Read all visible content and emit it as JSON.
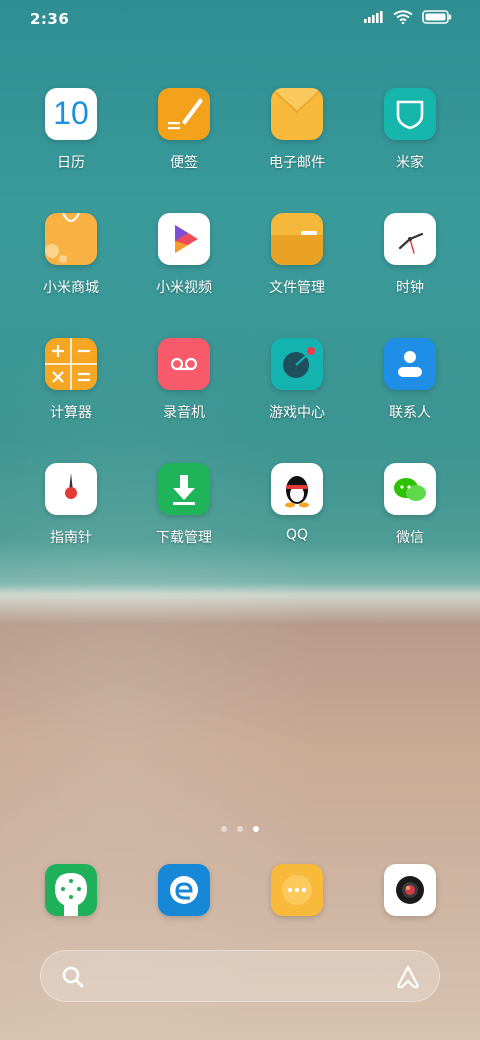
{
  "status_bar": {
    "time": "2:36",
    "icons": [
      "signal-icon",
      "wifi-icon",
      "battery-icon"
    ]
  },
  "apps": [
    {
      "label": "日历",
      "icon": "calendar-icon",
      "icon_text": "10",
      "color": "#ffffff"
    },
    {
      "label": "便签",
      "icon": "notes-icon",
      "color": "#f4a21b"
    },
    {
      "label": "电子邮件",
      "icon": "email-icon",
      "color": "#f9b93b"
    },
    {
      "label": "米家",
      "icon": "mihome-icon",
      "color": "#17b6ad"
    },
    {
      "label": "小米商城",
      "icon": "mall-icon",
      "color": "#f8b142"
    },
    {
      "label": "小米视频",
      "icon": "video-icon",
      "color": "#ffffff"
    },
    {
      "label": "文件管理",
      "icon": "folder-icon",
      "color": "#f6b83b"
    },
    {
      "label": "时钟",
      "icon": "clock-icon",
      "color": "#ffffff"
    },
    {
      "label": "计算器",
      "icon": "calculator-icon",
      "color": "#f5a623"
    },
    {
      "label": "录音机",
      "icon": "recorder-icon",
      "color": "#f75a6a"
    },
    {
      "label": "游戏中心",
      "icon": "game-center-icon",
      "color": "#15b3b0"
    },
    {
      "label": "联系人",
      "icon": "contacts-icon",
      "color": "#1e8ee6"
    },
    {
      "label": "指南针",
      "icon": "compass-icon",
      "color": "#ffffff"
    },
    {
      "label": "下载管理",
      "icon": "download-icon",
      "color": "#1fb35a"
    },
    {
      "label": "QQ",
      "icon": "qq-icon",
      "color": "#ffffff"
    },
    {
      "label": "微信",
      "icon": "wechat-icon",
      "color": "#ffffff"
    }
  ],
  "page_indicator": {
    "pages": 3,
    "active": 3
  },
  "dock": [
    {
      "icon": "phone-icon",
      "color": "#1fb15a"
    },
    {
      "icon": "browser-icon",
      "color": "#1787d8"
    },
    {
      "icon": "messages-icon",
      "color": "#f9b93b"
    },
    {
      "icon": "camera-icon",
      "color": "#ffffff"
    }
  ],
  "search_bar": {
    "left_icon": "search-icon",
    "right_icon": "assistant-icon"
  }
}
